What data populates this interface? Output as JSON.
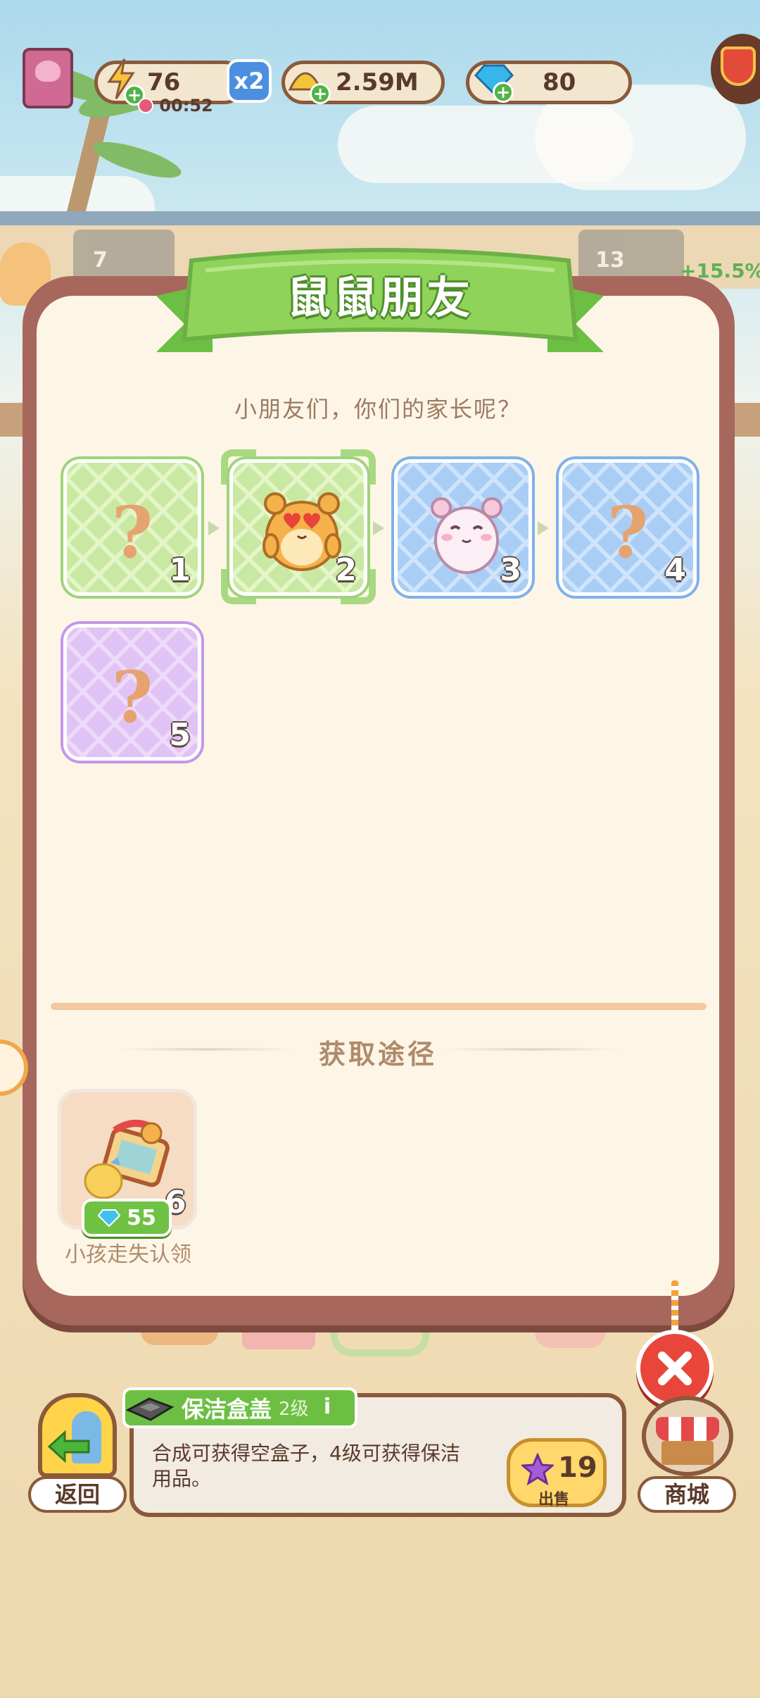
{
  "hud": {
    "energy_value": "76",
    "energy_timer": "00:52",
    "multiplier": "x2",
    "coins": "2.59M",
    "gems": "80"
  },
  "background": {
    "left_label": "7",
    "mid_label": "13",
    "right_percent": "+15.5%"
  },
  "dialog": {
    "title": "鼠鼠朋友",
    "subtitle": "小朋友们，你们的家长呢？",
    "cards": [
      {
        "level": "1",
        "state": "unknown",
        "theme": "green"
      },
      {
        "level": "2",
        "state": "unlocked",
        "theme": "green",
        "icon": "orange-hamster-heart-eyes-icon"
      },
      {
        "level": "3",
        "state": "unlocked",
        "theme": "blue",
        "icon": "white-hamster-icon"
      },
      {
        "level": "4",
        "state": "unknown",
        "theme": "blue"
      },
      {
        "level": "5",
        "state": "unknown",
        "theme": "purple"
      }
    ],
    "unknown_mark": "?",
    "section_title": "获取途径",
    "source": {
      "label": "小孩走失认领",
      "gem_cost": "55",
      "count": "6",
      "icon": "lost-child-booth-icon"
    }
  },
  "bottom": {
    "back_label": "返回",
    "shop_label": "商城",
    "item_name": "保洁盒盖",
    "item_level": "2级",
    "item_desc": "合成可获得空盒子，4级可获得保洁用品。",
    "sell_value": "19",
    "sell_label": "出售"
  },
  "colors": {
    "dialog_border": "#a8675c",
    "dialog_bg": "#fdf6e6",
    "ribbon_green": "#7ccc52",
    "close_red": "#e8463b",
    "accent_brown": "#8a5a3a"
  }
}
